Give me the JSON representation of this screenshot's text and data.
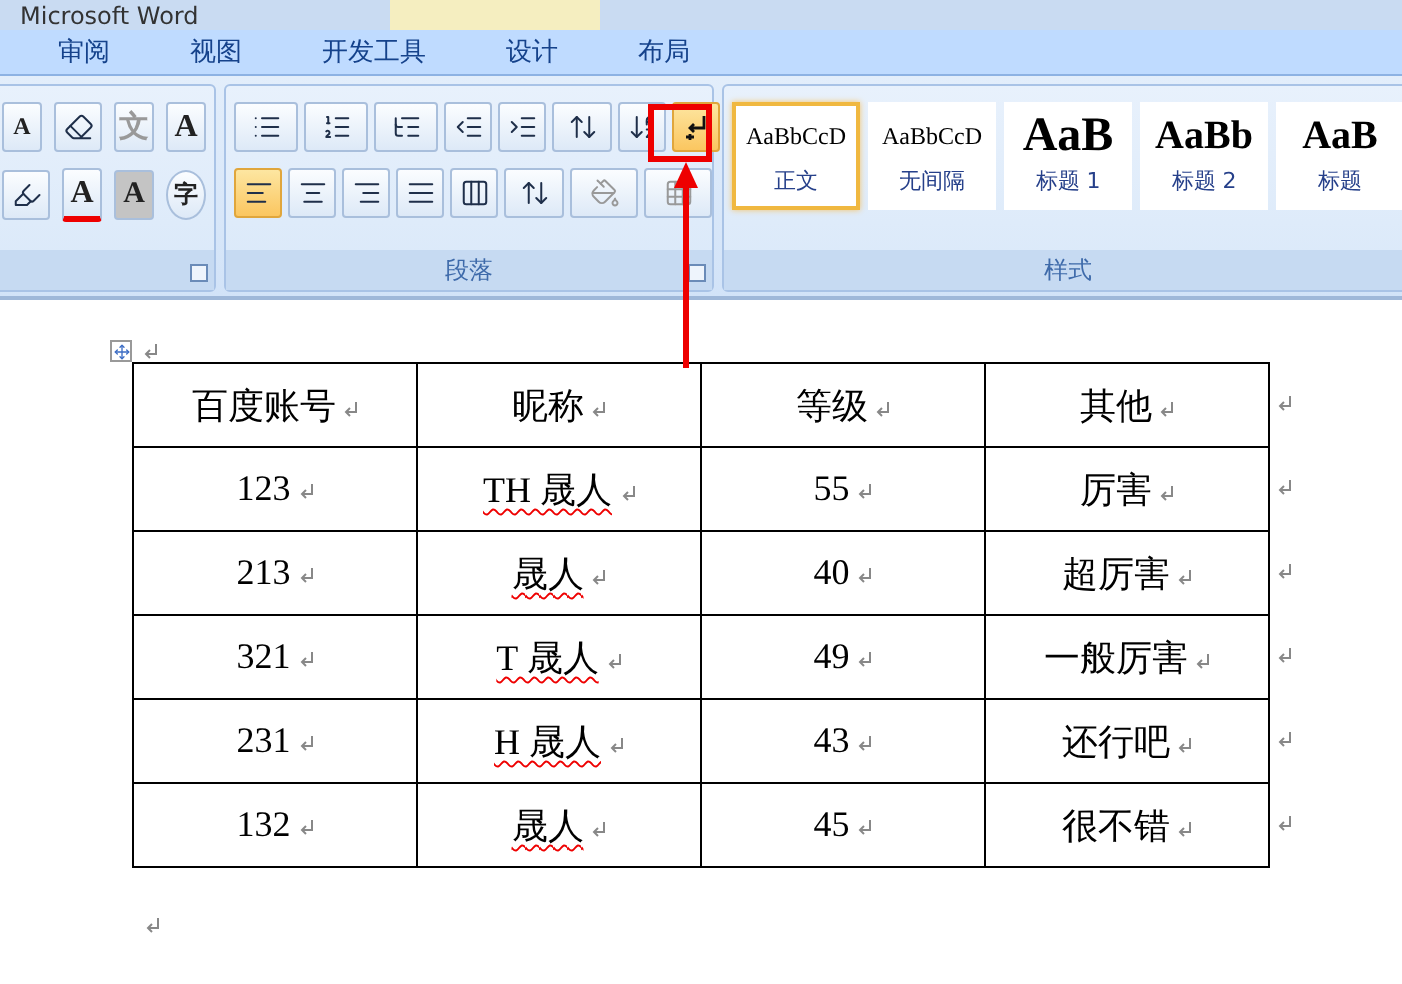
{
  "window": {
    "title": "Microsoft Word"
  },
  "tabs": [
    {
      "label": "审阅",
      "selected": false
    },
    {
      "label": "视图",
      "selected": false
    },
    {
      "label": "开发工具",
      "selected": false
    },
    {
      "label": "设计",
      "selected": false
    },
    {
      "label": "布局",
      "selected": false
    }
  ],
  "font_group": {
    "buttons": [
      {
        "kind": "grow",
        "glyph": "A"
      },
      {
        "kind": "clear"
      },
      {
        "kind": "phonetic",
        "glyph": "文"
      },
      {
        "kind": "border",
        "glyph": "A"
      },
      {
        "kind": "highlight"
      },
      {
        "kind": "color",
        "glyph": "A"
      },
      {
        "kind": "shading",
        "glyph": "A"
      },
      {
        "kind": "enclose",
        "glyph": "字"
      }
    ]
  },
  "paragraph_group": {
    "label": "段落",
    "alignments": [
      {
        "selected": true
      },
      {
        "selected": false
      },
      {
        "selected": false
      },
      {
        "selected": false
      },
      {
        "selected": false
      }
    ],
    "show_marks": {
      "selected": true
    }
  },
  "styles_group": {
    "label": "样式",
    "styles": [
      {
        "preview": "AaBbCcD",
        "label": "正文",
        "kind": "body",
        "selected": true
      },
      {
        "preview": "AaBbCcD",
        "label": "无间隔",
        "kind": "body",
        "selected": false
      },
      {
        "preview": "AaB",
        "label": "标题 1",
        "kind": "heading1",
        "selected": false
      },
      {
        "preview": "AaBb",
        "label": "标题 2",
        "kind": "heading2",
        "selected": false
      },
      {
        "preview": "AaB",
        "label": "标题",
        "kind": "heading2",
        "selected": false
      }
    ]
  },
  "table": {
    "rows": [
      [
        {
          "text": "百度账号",
          "flagged": false
        },
        {
          "text": "昵称",
          "flagged": false
        },
        {
          "text": "等级",
          "flagged": false
        },
        {
          "text": "其他",
          "flagged": false
        }
      ],
      [
        {
          "text": "123",
          "flagged": false
        },
        {
          "text": "TH 晟人",
          "flagged": true
        },
        {
          "text": "55",
          "flagged": false
        },
        {
          "text": "厉害",
          "flagged": false
        }
      ],
      [
        {
          "text": "213",
          "flagged": false
        },
        {
          "text": "晟人",
          "flagged": true
        },
        {
          "text": "40",
          "flagged": false
        },
        {
          "text": "超厉害",
          "flagged": false
        }
      ],
      [
        {
          "text": "321",
          "flagged": false
        },
        {
          "text": "T 晟人",
          "flagged": true
        },
        {
          "text": "49",
          "flagged": false
        },
        {
          "text": "一般厉害",
          "flagged": false
        }
      ],
      [
        {
          "text": "231",
          "flagged": false
        },
        {
          "text": "H 晟人",
          "flagged": true
        },
        {
          "text": "43",
          "flagged": false
        },
        {
          "text": "还行吧",
          "flagged": false
        }
      ],
      [
        {
          "text": "132",
          "flagged": false
        },
        {
          "text": "晟人",
          "flagged": true
        },
        {
          "text": "45",
          "flagged": false
        },
        {
          "text": "很不错",
          "flagged": false
        }
      ]
    ]
  }
}
